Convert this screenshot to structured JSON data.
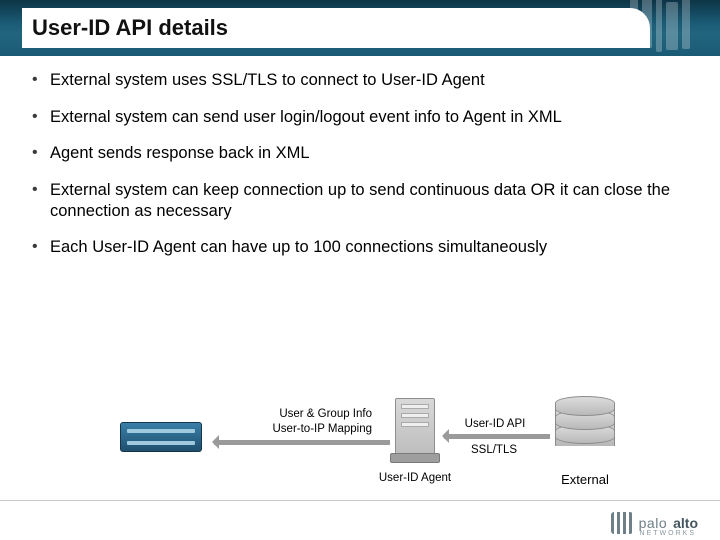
{
  "title": "User-ID API details",
  "bullets": [
    "External system uses SSL/TLS to connect to User-ID Agent",
    "External system can send user login/logout event info to Agent in XML",
    "Agent  sends response back in XML",
    "External system can keep connection up to send continuous data OR it can close the connection as necessary",
    "Each User-ID Agent can have up to 100 connections simultaneously"
  ],
  "diagram": {
    "left_label_line1": "User & Group Info",
    "left_label_line2": "User-to-IP Mapping",
    "mid_label": "User-ID API",
    "ssl_label": "SSL/TLS",
    "server_label": "User-ID Agent",
    "db_label": "External"
  },
  "logo": {
    "part1": "palo",
    "part2": "alto",
    "sub": "NETWORKS"
  }
}
